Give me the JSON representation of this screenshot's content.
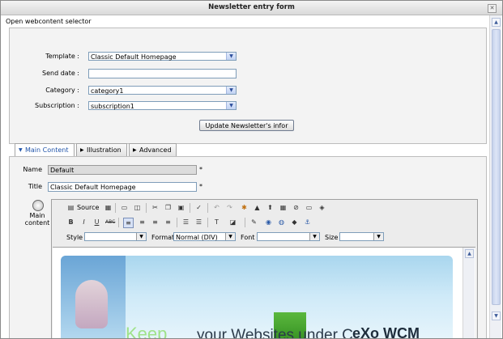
{
  "window": {
    "title": "Newsletter entry form"
  },
  "top_link": "Open webcontent selector",
  "form": {
    "template_label": "Template :",
    "template_value": "Classic Default Homepage",
    "send_date_label": "Send date :",
    "send_date_value": "",
    "category_label": "Category :",
    "category_value": "category1",
    "subscription_label": "Subscription :",
    "subscription_value": "subscription1",
    "update_button": "Update Newsletter's infor"
  },
  "tabs": [
    {
      "label": "Main Content"
    },
    {
      "label": "Illustration"
    },
    {
      "label": "Advanced"
    }
  ],
  "main": {
    "name_label": "Name",
    "name_value": "Default",
    "title_label": "Title",
    "title_value": "Classic Default Homepage",
    "required_mark": "*",
    "main_content_label_1": "Main",
    "main_content_label_2": "content"
  },
  "editor": {
    "source_label": "Source",
    "style_label": "Style",
    "style_value": "",
    "format_label": "Format",
    "format_value": "Normal (DIV)",
    "font_label": "Font",
    "font_value": "",
    "size_label": "Size",
    "size_value": "",
    "banner_text_1": "Keep",
    "banner_text_2": "your Websites under C",
    "banner_logo": "eXo WCM"
  },
  "colors": {
    "accent": "#2255aa",
    "titlebar": "#d9d9d9",
    "panel_bg": "#f3f3f3"
  }
}
